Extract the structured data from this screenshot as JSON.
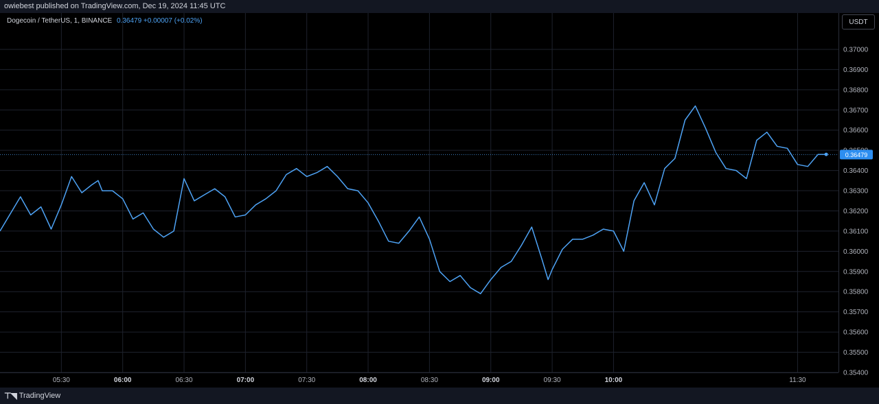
{
  "header": {
    "published": "owiebest published on TradingView.com, Dec 19, 2024 11:45 UTC"
  },
  "legend": {
    "symbol": "Dogecoin / TetherUS, 1, BINANCE",
    "quote": "0.36479 +0.00007 (+0.02%)"
  },
  "currency_button": "USDT",
  "footer": {
    "brand": "TradingView",
    "logo_icon": "tradingview-logo-icon"
  },
  "colors": {
    "line": "#4ea3f5",
    "background": "#000000",
    "grid": "#1e222d",
    "badge": "#2d8ef0"
  },
  "chart_data": {
    "type": "line",
    "title": "Dogecoin / TetherUS, 1, BINANCE",
    "last_price": 0.36479,
    "last_price_label": "0.36479",
    "ylim": [
      0.354,
      0.3718
    ],
    "yticks": [
      "0.37000",
      "0.36900",
      "0.36800",
      "0.36700",
      "0.36600",
      "0.36500",
      "0.36400",
      "0.36300",
      "0.36200",
      "0.36100",
      "0.36000",
      "0.35900",
      "0.35800",
      "0.35700",
      "0.35600",
      "0.35500",
      "0.35400"
    ],
    "xlim": [
      "05:00",
      "11:50"
    ],
    "xticks": [
      {
        "label": "05:30",
        "bold": false
      },
      {
        "label": "06:00",
        "bold": true
      },
      {
        "label": "06:30",
        "bold": false
      },
      {
        "label": "07:00",
        "bold": true
      },
      {
        "label": "07:30",
        "bold": false
      },
      {
        "label": "08:00",
        "bold": true
      },
      {
        "label": "08:30",
        "bold": false
      },
      {
        "label": "09:00",
        "bold": true
      },
      {
        "label": "09:30",
        "bold": false
      },
      {
        "label": "10:00",
        "bold": true
      },
      {
        "label": "11:30",
        "bold": false
      }
    ],
    "series": [
      {
        "time": [
          "05:00",
          "05:10",
          "05:15",
          "05:20",
          "05:25",
          "05:30",
          "05:35",
          "05:40",
          "05:45",
          "05:48",
          "05:50",
          "05:55",
          "06:00",
          "06:05",
          "06:10",
          "06:15",
          "06:20",
          "06:25",
          "06:30",
          "06:35",
          "06:40",
          "06:45",
          "06:50",
          "06:55",
          "07:00",
          "07:05",
          "07:10",
          "07:15",
          "07:20",
          "07:25",
          "07:30",
          "07:35",
          "07:40",
          "07:45",
          "07:50",
          "07:55",
          "08:00",
          "08:05",
          "08:10",
          "08:15",
          "08:20",
          "08:25",
          "08:30",
          "08:35",
          "08:40",
          "08:45",
          "08:50",
          "08:55",
          "09:00",
          "09:05",
          "09:10",
          "09:15",
          "09:20",
          "09:25",
          "09:28",
          "09:30",
          "09:35",
          "09:40",
          "09:45",
          "09:50",
          "09:55",
          "10:00",
          "10:05",
          "10:10",
          "10:15",
          "10:20",
          "10:25",
          "10:30",
          "10:35",
          "10:40",
          "10:45",
          "10:50",
          "10:55",
          "11:00",
          "11:05",
          "11:10",
          "11:15",
          "11:20",
          "11:25",
          "11:30",
          "11:35",
          "11:40",
          "11:44"
        ],
        "values": [
          0.361,
          0.3627,
          0.3618,
          0.3622,
          0.3611,
          0.3623,
          0.3637,
          0.3629,
          0.3633,
          0.3635,
          0.363,
          0.363,
          0.3626,
          0.3616,
          0.3619,
          0.3611,
          0.3607,
          0.361,
          0.3636,
          0.3625,
          0.3628,
          0.3631,
          0.3627,
          0.3617,
          0.3618,
          0.3623,
          0.3626,
          0.363,
          0.3638,
          0.3641,
          0.3637,
          0.3639,
          0.3642,
          0.3637,
          0.3631,
          0.363,
          0.3624,
          0.3615,
          0.3605,
          0.3604,
          0.361,
          0.3617,
          0.3606,
          0.359,
          0.3585,
          0.3588,
          0.3582,
          0.3579,
          0.3586,
          0.3592,
          0.3595,
          0.3603,
          0.3612,
          0.3596,
          0.3586,
          0.3591,
          0.3601,
          0.3606,
          0.3606,
          0.3608,
          0.3611,
          0.361,
          0.36,
          0.3625,
          0.3634,
          0.3623,
          0.3641,
          0.3646,
          0.3665,
          0.3672,
          0.3661,
          0.3649,
          0.3641,
          0.364,
          0.3636,
          0.3655,
          0.3659,
          0.3652,
          0.3651,
          0.3643,
          0.3642,
          0.3648,
          0.3648
        ]
      }
    ],
    "grid": true
  }
}
